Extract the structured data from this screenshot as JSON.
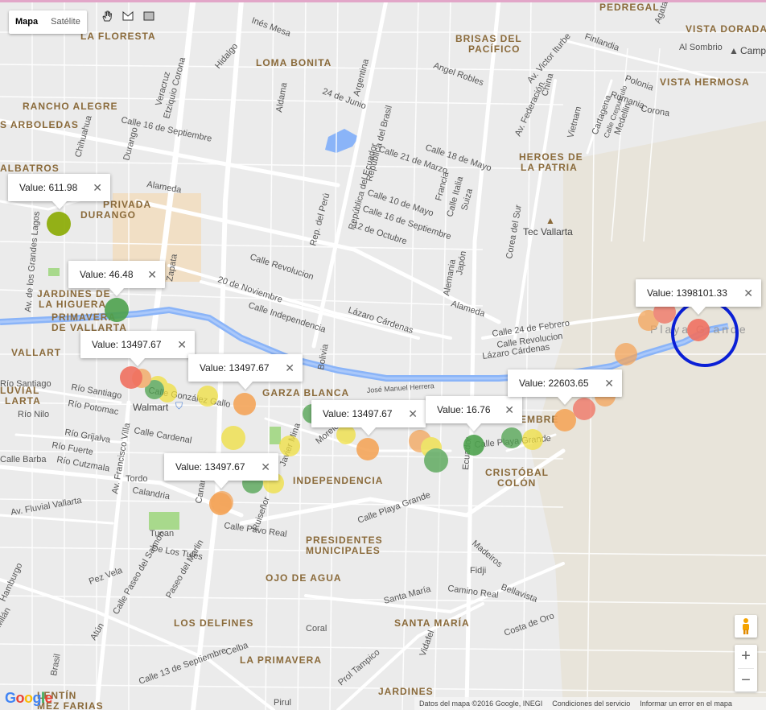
{
  "map_type": {
    "map": "Mapa",
    "satellite": "Satélite",
    "selected": "map"
  },
  "tools": [
    "hand-icon",
    "polyline-icon",
    "rectangle-icon"
  ],
  "neighborhoods": [
    {
      "name": "LA FLORESTA",
      "id": "n1"
    },
    {
      "name": "LOMA BONITA",
      "id": "n2"
    },
    {
      "name": "BRISAS DEL",
      "id": "n3a"
    },
    {
      "name": "PACÍFICO",
      "id": "n3b"
    },
    {
      "name": "PEDREGAL",
      "id": "n4"
    },
    {
      "name": "VISTA DORADA",
      "id": "n5"
    },
    {
      "name": "VISTA HERMOSA",
      "id": "n6"
    },
    {
      "name": "RANCHO ALEGRE",
      "id": "n7"
    },
    {
      "name": "S ARBOLEDAS",
      "id": "n8"
    },
    {
      "name": "HEROES DE",
      "id": "n9a"
    },
    {
      "name": "LA PATRIA",
      "id": "n9b"
    },
    {
      "name": "ALBATROS",
      "id": "n10"
    },
    {
      "name": "PRIVADA",
      "id": "n11a"
    },
    {
      "name": "DURANGO",
      "id": "n11b"
    },
    {
      "name": "JARDINES DE",
      "id": "n12a"
    },
    {
      "name": "LA HIGUERA",
      "id": "n12b"
    },
    {
      "name": "PRIMAVERA",
      "id": "n13a"
    },
    {
      "name": "DE VALLARTA",
      "id": "n13b"
    },
    {
      "name": "VALLART",
      "id": "n14"
    },
    {
      "name": "LUVIAL",
      "id": "n15a"
    },
    {
      "name": "LARTA",
      "id": "n15b"
    },
    {
      "name": "GARZA BLANCA",
      "id": "n16"
    },
    {
      "name": "INDEPENDENCIA",
      "id": "n17"
    },
    {
      "name": "CRISTÓBAL",
      "id": "n18a"
    },
    {
      "name": "COLÓN",
      "id": "n18b"
    },
    {
      "name": "PRESIDENTES",
      "id": "n19a"
    },
    {
      "name": "MUNICIPALES",
      "id": "n19b"
    },
    {
      "name": "OJO DE AGUA",
      "id": "n20"
    },
    {
      "name": "LOS DELFINES",
      "id": "n21"
    },
    {
      "name": "SANTA MARÍA",
      "id": "n22"
    },
    {
      "name": "LA PRIMAVERA",
      "id": "n23"
    },
    {
      "name": "JARDINES",
      "id": "n24"
    },
    {
      "name": "LENTÍN",
      "id": "n25a"
    },
    {
      "name": "MEZ FARIAS",
      "id": "n25b"
    },
    {
      "name": "EMBRE",
      "id": "n26"
    }
  ],
  "places": {
    "tec": "Tec Vallarta",
    "walmart": "Walmart",
    "camp": "Camp",
    "playa": "Playa Grande"
  },
  "streets": {
    "s1": "Calle 16 de Septiembre",
    "s2": "Calle Revolucion",
    "s3": "20 de Noviembre",
    "s4": "Calle Independencia",
    "s5": "Lázaro Cárdenas",
    "s6": "Alameda",
    "s7": "Calle 21 de Marzo",
    "s8": "Calle 18 de Mayo",
    "s9": "Calle 10 de Mayo",
    "s10": "Calle 16 de Septiembre",
    "s11": "12 de Octubre",
    "s12": "Calle 24 de Febrero",
    "s13": "Calle Revolucion",
    "s14": "Lázaro Cárdenas",
    "s15": "Río Santiago",
    "s16": "Río Potomac",
    "s17": "Río Nilo",
    "s18": "Río Grijalva",
    "s19": "Río Fuerte",
    "s20": "Río Cutzmala",
    "s21": "Calle Cardenal",
    "s22": "Calle Playa Grande",
    "s23": "Calle Pavo Real",
    "s24": "Calle González Gallo",
    "s25": "Av. Francisco Villa",
    "s26": "Calandria",
    "s27": "Tucan",
    "s28": "De Los Tules",
    "s29": "Paseo del Marlin",
    "s30": "Calle Paseo del Salmón",
    "s31": "Santa María",
    "s32": "Camino Real",
    "s33": "Calle 13 de Septiembre",
    "s34": "Prol Tampico",
    "s35": "Angel Robles",
    "s36": "Av. Federación",
    "s37": "Av. Victor Iturbe",
    "s38": "Finlandia",
    "s39": "Polonia",
    "s40": "Rumania",
    "s41": "Ecuador",
    "s42": "Japón",
    "s43": "Alemania",
    "s44": "Bolivia",
    "s45": "Rep. del Perú",
    "s46": "República del Ecuador",
    "s47": "República del Brasil",
    "s48": "Argentina",
    "s49": "24 de Junio",
    "s50": "Hidalgo",
    "s51": "Veracruz",
    "s52": "Etziquio Corona",
    "s53": "Durango",
    "s54": "Chihuahua",
    "s55": "Av. de los Grandes Lagos",
    "s56": "José Manuel Herrera",
    "s57": "Morelos",
    "s58": "Javier Mina",
    "s59": "Ruiseñor",
    "s60": "Av. Fluvial Vallarta",
    "s61": "Hamburgo",
    "s62": "Pez Vela",
    "s63": "Atún",
    "s64": "Celba",
    "s65": "Coral",
    "s66": "Costa de Oro",
    "s67": "Bellavista",
    "s68": "Madeiros",
    "s69": "Fidji",
    "s70": "Vidafel",
    "s71": "Pirul",
    "s72": "Inés Mesa",
    "s73": "Al Sombrio",
    "s74": "Corea del Sur",
    "s75": "Aldama",
    "s76": "Francia",
    "s77": "Calle Italia",
    "s78": "Suiza",
    "s79": "China",
    "s80": "Vietnam",
    "s81": "Cartagena",
    "s82": "Medellin",
    "s83": "Calle Crepusculo",
    "s84": "Corona",
    "s85": "Canario",
    "s86": "Tordo",
    "s87": "Alameda",
    "s88": "Calle Playa Grande",
    "s89": "Río Santiago",
    "s90": "Milán",
    "s91": "Brasil",
    "s92": "Agata",
    "s93": "Calle Barba",
    "s94": "Zapata",
    "s95": "Calle Playa Grande"
  },
  "markers": [
    {
      "id": "m1",
      "color": "#8aaa00",
      "value": "611.98"
    },
    {
      "id": "m2",
      "color": "#4ea24e",
      "value": "46.48"
    },
    {
      "id": "m3",
      "color": "#f07060",
      "value": "13497.67"
    },
    {
      "id": "m4",
      "color": "#f4a55a",
      "value": "13497.67"
    },
    {
      "id": "m5",
      "color": "#f4a55a",
      "value": "13497.67"
    },
    {
      "id": "m6",
      "color": "#4ea24e",
      "value": "16.76"
    },
    {
      "id": "m7",
      "color": "#f4a55a",
      "value": "13497.67"
    },
    {
      "id": "m8",
      "color": "#f4a55a",
      "value": "22603.65"
    },
    {
      "id": "m9",
      "color": "#f07060",
      "value": "1398101.33"
    }
  ],
  "infowindow_prefix": "Value: ",
  "close_glyph": "✕",
  "zoom": {
    "in": "+",
    "out": "−"
  },
  "footer": {
    "data": "Datos del mapa ©2016 Google, INEGI",
    "terms": "Condiciones del servicio",
    "report": "Informar un error en el mapa"
  },
  "logo": [
    "G",
    "o",
    "o",
    "g",
    "l",
    "e"
  ],
  "colors": {
    "highlight_ring": "#0a1fd6",
    "river": "#8ab4f8",
    "park": "#a6d98a",
    "campus": "#f1d9b7"
  }
}
